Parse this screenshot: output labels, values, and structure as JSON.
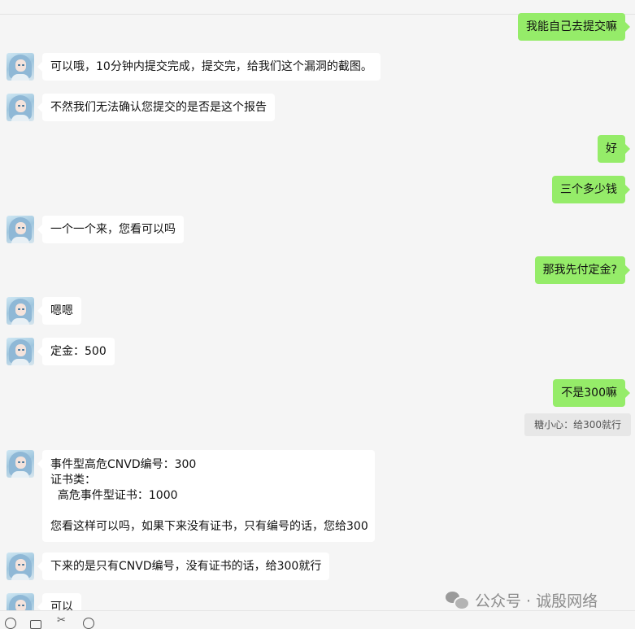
{
  "messages": [
    {
      "side": "out",
      "text": "我能自己去提交嘛"
    },
    {
      "side": "in",
      "text": "可以哦，10分钟内提交完成，提交完，给我们这个漏洞的截图。"
    },
    {
      "side": "in",
      "text": "不然我们无法确认您提交的是否是这个报告"
    },
    {
      "side": "out",
      "text": "好"
    },
    {
      "side": "out",
      "text": "三个多少钱"
    },
    {
      "side": "in",
      "text": "一个一个来，您看可以吗"
    },
    {
      "side": "out",
      "text": "那我先付定金?"
    },
    {
      "side": "in",
      "text": "嗯嗯"
    },
    {
      "side": "in",
      "text": "定金：500"
    },
    {
      "side": "out",
      "text": "不是300嘛"
    },
    {
      "side": "quote",
      "text": "糖小心：给300就行"
    },
    {
      "side": "in",
      "lines": [
        "事件型高危CNVD编号：300",
        "证书类：",
        "  高危事件型证书：1000",
        "",
        "您看这样可以吗，如果下来没有证书，只有编号的话，您给300"
      ]
    },
    {
      "side": "in",
      "text": "下来的是只有CNVD编号，没有证书的话，给300就行"
    },
    {
      "side": "in",
      "text": "可以"
    }
  ],
  "watermark": {
    "text": "公众号 · 诚殷网络",
    "icon": "wechat-logo-icon"
  },
  "toolbar": {
    "icons": [
      "emoji-icon",
      "folder-icon",
      "scissors-icon",
      "chat-history-icon"
    ],
    "scissors_glyph": "✂"
  },
  "colors": {
    "background": "#f5f5f5",
    "incoming_bubble": "#ffffff",
    "outgoing_bubble": "#95ec69",
    "quote_bg": "#e7e7e7"
  }
}
